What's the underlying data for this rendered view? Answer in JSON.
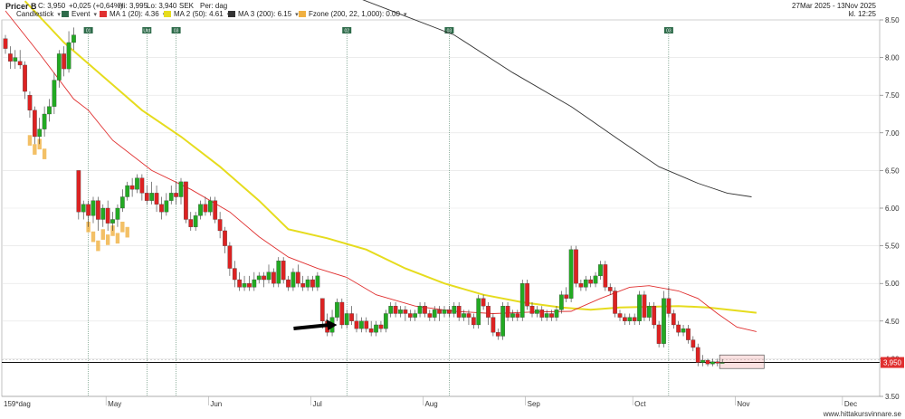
{
  "header": {
    "instrument": "Pricer B",
    "close": "C: 3,950",
    "change": "+0,025 (+0,64%)",
    "high": "Hi: 3,995",
    "low": "Lo: 3,940",
    "currency": "SEK",
    "period": "Per: dag",
    "date_range": "27Mar 2025 - 13Nov 2025",
    "time": "kl. 12:25",
    "legend": [
      {
        "label": "Candlestick",
        "color": "",
        "dropdown": "▾"
      },
      {
        "label": "Event",
        "color": "#2e6b4a",
        "dropdown": "▾"
      },
      {
        "label": "MA 1 (20): 4.36",
        "color": "#e03030",
        "dropdown": "▾"
      },
      {
        "label": "MA 2 (50): 4.61",
        "color": "#e6dc1e",
        "dropdown": "▾"
      },
      {
        "label": "MA 3 (200): 6.15",
        "color": "#333333",
        "dropdown": "▾"
      },
      {
        "label": "Fzone (200, 22, 1,000): 0.00",
        "color": "#f0b040",
        "dropdown": "▾"
      }
    ]
  },
  "range_label": "159*dag",
  "price_marker": "3,950",
  "footer": "www.hittakursvinnare.se",
  "colors": {
    "up": "#22aa22",
    "down": "#dd2222",
    "ma1": "#e03030",
    "ma2": "#e6dc1e",
    "ma3": "#333333",
    "fzone": "#f0b040",
    "event": "#2e6b4a",
    "marker_bg": "#e03030"
  },
  "chart_data": {
    "type": "candlestick",
    "ylim": [
      3.5,
      8.5
    ],
    "y_ticks": [
      "3.50",
      "4.00",
      "4.50",
      "5.00",
      "5.50",
      "6.00",
      "6.50",
      "7.00",
      "7.50",
      "8.00",
      "8.50"
    ],
    "y_tick_values": [
      3.5,
      4.0,
      4.5,
      5.0,
      5.5,
      6.0,
      6.5,
      7.0,
      7.5,
      8.0,
      8.5
    ],
    "month_labels": [
      "May",
      "Jun",
      "Jul",
      "Aug",
      "Sep",
      "Oct",
      "Nov",
      "Dec"
    ],
    "month_index": [
      21,
      42,
      63,
      86,
      107,
      129,
      150,
      172
    ],
    "num_slots": 180,
    "events": [
      {
        "label": "01",
        "index": 17
      },
      {
        "label": "Utd",
        "index": 29
      },
      {
        "label": "03",
        "index": 35
      },
      {
        "label": "02",
        "index": 70
      },
      {
        "label": "03",
        "index": 91
      },
      {
        "label": "03",
        "index": 136
      }
    ],
    "candles": [
      [
        8.25,
        8.12,
        8.3,
        8.05
      ],
      [
        8.05,
        7.95,
        8.15,
        7.85
      ],
      [
        7.95,
        8.0,
        8.1,
        7.85
      ],
      [
        7.95,
        7.9,
        8.1,
        7.85
      ],
      [
        7.9,
        7.55,
        7.95,
        7.45
      ],
      [
        7.5,
        7.3,
        7.55,
        7.2
      ],
      [
        7.3,
        6.95,
        7.35,
        6.85
      ],
      [
        6.95,
        7.05,
        7.2,
        6.85
      ],
      [
        7.05,
        7.25,
        7.35,
        6.95
      ],
      [
        7.25,
        7.35,
        7.45,
        7.15
      ],
      [
        7.35,
        7.7,
        7.8,
        7.25
      ],
      [
        7.7,
        8.05,
        8.1,
        7.6
      ],
      [
        8.05,
        7.85,
        8.15,
        7.75
      ],
      [
        7.85,
        8.2,
        8.35,
        7.8
      ],
      [
        8.2,
        8.3,
        8.4,
        8.1
      ],
      [
        6.5,
        5.95,
        6.5,
        5.85
      ],
      [
        5.95,
        6.05,
        6.1,
        5.85
      ],
      [
        6.05,
        5.9,
        6.1,
        5.75
      ],
      [
        5.9,
        6.1,
        6.15,
        5.8
      ],
      [
        6.1,
        5.85,
        6.15,
        5.7
      ],
      [
        5.85,
        6.0,
        6.05,
        5.75
      ],
      [
        6.0,
        5.8,
        6.1,
        5.7
      ],
      [
        5.8,
        5.85,
        5.95,
        5.7
      ],
      [
        5.85,
        6.0,
        6.05,
        5.75
      ],
      [
        6.0,
        6.15,
        6.25,
        5.95
      ],
      [
        6.15,
        6.3,
        6.35,
        6.1
      ],
      [
        6.3,
        6.25,
        6.4,
        6.15
      ],
      [
        6.25,
        6.4,
        6.45,
        6.2
      ],
      [
        6.4,
        6.2,
        6.45,
        6.1
      ],
      [
        6.2,
        6.1,
        6.3,
        6.05
      ],
      [
        6.1,
        6.2,
        6.35,
        6.05
      ],
      [
        6.2,
        6.05,
        6.3,
        5.95
      ],
      [
        6.05,
        5.95,
        6.15,
        5.85
      ],
      [
        5.95,
        6.1,
        6.2,
        5.9
      ],
      [
        6.1,
        6.2,
        6.3,
        6.05
      ],
      [
        6.2,
        6.15,
        6.35,
        6.05
      ],
      [
        6.15,
        6.35,
        6.4,
        6.05
      ],
      [
        6.35,
        5.85,
        6.35,
        5.8
      ],
      [
        5.85,
        5.75,
        5.95,
        5.7
      ],
      [
        5.75,
        5.9,
        5.95,
        5.7
      ],
      [
        5.9,
        6.05,
        6.1,
        5.85
      ],
      [
        6.05,
        5.95,
        6.15,
        5.9
      ],
      [
        5.95,
        6.1,
        6.15,
        5.9
      ],
      [
        6.1,
        5.85,
        6.15,
        5.8
      ],
      [
        5.85,
        5.7,
        5.95,
        5.6
      ],
      [
        5.7,
        5.5,
        5.75,
        5.4
      ],
      [
        5.5,
        5.2,
        5.55,
        5.1
      ],
      [
        5.2,
        5.05,
        5.3,
        4.95
      ],
      [
        5.05,
        4.95,
        5.15,
        4.9
      ],
      [
        4.95,
        5.0,
        5.1,
        4.9
      ],
      [
        5.0,
        4.95,
        5.1,
        4.9
      ],
      [
        4.95,
        5.05,
        5.15,
        4.9
      ],
      [
        5.05,
        5.1,
        5.15,
        5.0
      ],
      [
        5.1,
        5.05,
        5.15,
        4.95
      ],
      [
        5.05,
        5.15,
        5.25,
        5.0
      ],
      [
        5.15,
        5.0,
        5.2,
        4.95
      ],
      [
        5.0,
        5.3,
        5.35,
        4.95
      ],
      [
        5.3,
        5.05,
        5.35,
        5.0
      ],
      [
        5.05,
        4.95,
        5.1,
        4.9
      ],
      [
        4.95,
        5.15,
        5.2,
        4.9
      ],
      [
        5.15,
        5.0,
        5.25,
        4.95
      ],
      [
        5.0,
        4.95,
        5.1,
        4.9
      ],
      [
        4.95,
        5.05,
        5.1,
        4.9
      ],
      [
        5.05,
        4.95,
        5.1,
        4.9
      ],
      [
        4.95,
        5.1,
        5.15,
        4.9
      ],
      [
        4.8,
        4.5,
        4.8,
        4.4
      ],
      [
        4.5,
        4.35,
        4.6,
        4.3
      ],
      [
        4.35,
        4.55,
        4.65,
        4.3
      ],
      [
        4.55,
        4.75,
        4.8,
        4.5
      ],
      [
        4.75,
        4.45,
        4.8,
        4.4
      ],
      [
        4.45,
        4.6,
        4.65,
        4.4
      ],
      [
        4.6,
        4.5,
        4.7,
        4.45
      ],
      [
        4.5,
        4.4,
        4.6,
        4.35
      ],
      [
        4.4,
        4.5,
        4.55,
        4.35
      ],
      [
        4.5,
        4.4,
        4.55,
        4.35
      ],
      [
        4.4,
        4.35,
        4.5,
        4.3
      ],
      [
        4.35,
        4.45,
        4.5,
        4.3
      ],
      [
        4.45,
        4.4,
        4.5,
        4.35
      ],
      [
        4.4,
        4.6,
        4.65,
        4.35
      ],
      [
        4.6,
        4.7,
        4.75,
        4.55
      ],
      [
        4.7,
        4.6,
        4.75,
        4.55
      ],
      [
        4.6,
        4.65,
        4.7,
        4.55
      ],
      [
        4.65,
        4.6,
        4.7,
        4.5
      ],
      [
        4.6,
        4.55,
        4.65,
        4.5
      ],
      [
        4.55,
        4.6,
        4.65,
        4.5
      ],
      [
        4.6,
        4.7,
        4.75,
        4.55
      ],
      [
        4.7,
        4.6,
        4.75,
        4.55
      ],
      [
        4.6,
        4.55,
        4.65,
        4.5
      ],
      [
        4.55,
        4.65,
        4.7,
        4.5
      ],
      [
        4.65,
        4.6,
        4.7,
        4.5
      ],
      [
        4.6,
        4.65,
        4.7,
        4.55
      ],
      [
        4.65,
        4.6,
        4.7,
        4.55
      ],
      [
        4.6,
        4.7,
        4.75,
        4.55
      ],
      [
        4.7,
        4.55,
        4.75,
        4.5
      ],
      [
        4.55,
        4.6,
        4.65,
        4.5
      ],
      [
        4.6,
        4.55,
        4.65,
        4.45
      ],
      [
        4.55,
        4.45,
        4.6,
        4.4
      ],
      [
        4.45,
        4.8,
        4.85,
        4.4
      ],
      [
        4.8,
        4.7,
        4.85,
        4.65
      ],
      [
        4.7,
        4.55,
        4.75,
        4.45
      ],
      [
        4.55,
        4.35,
        4.6,
        4.3
      ],
      [
        4.35,
        4.3,
        4.4,
        4.25
      ],
      [
        4.3,
        4.7,
        4.75,
        4.25
      ],
      [
        4.7,
        4.55,
        4.75,
        4.5
      ],
      [
        4.55,
        4.6,
        4.65,
        4.5
      ],
      [
        4.6,
        4.55,
        4.65,
        4.5
      ],
      [
        4.55,
        5.0,
        5.05,
        4.5
      ],
      [
        5.0,
        4.7,
        5.05,
        4.65
      ],
      [
        4.7,
        4.6,
        4.75,
        4.55
      ],
      [
        4.6,
        4.65,
        4.7,
        4.55
      ],
      [
        4.65,
        4.55,
        4.7,
        4.5
      ],
      [
        4.55,
        4.6,
        4.65,
        4.5
      ],
      [
        4.6,
        4.55,
        4.65,
        4.5
      ],
      [
        4.55,
        4.65,
        4.7,
        4.5
      ],
      [
        4.65,
        4.85,
        4.9,
        4.6
      ],
      [
        4.85,
        4.8,
        4.95,
        4.75
      ],
      [
        4.8,
        5.45,
        5.5,
        4.75
      ],
      [
        5.45,
        5.0,
        5.5,
        4.95
      ],
      [
        5.0,
        4.95,
        5.05,
        4.9
      ],
      [
        4.95,
        5.05,
        5.1,
        4.9
      ],
      [
        5.05,
        5.0,
        5.1,
        4.95
      ],
      [
        5.0,
        5.1,
        5.15,
        4.95
      ],
      [
        5.1,
        5.25,
        5.3,
        5.05
      ],
      [
        5.25,
        4.95,
        5.3,
        4.9
      ],
      [
        4.95,
        4.9,
        5.0,
        4.85
      ],
      [
        4.9,
        4.6,
        4.95,
        4.55
      ],
      [
        4.6,
        4.55,
        4.65,
        4.5
      ],
      [
        4.55,
        4.5,
        4.6,
        4.45
      ],
      [
        4.5,
        4.55,
        4.6,
        4.45
      ],
      [
        4.55,
        4.5,
        4.6,
        4.45
      ],
      [
        4.5,
        4.85,
        4.9,
        4.45
      ],
      [
        4.85,
        4.55,
        4.9,
        4.5
      ],
      [
        4.55,
        4.7,
        4.75,
        4.5
      ],
      [
        4.7,
        4.45,
        4.75,
        4.4
      ],
      [
        4.45,
        4.2,
        4.5,
        4.15
      ],
      [
        4.2,
        4.8,
        4.9,
        4.15
      ],
      [
        4.8,
        4.6,
        4.95,
        4.55
      ],
      [
        4.6,
        4.45,
        4.65,
        4.4
      ],
      [
        4.45,
        4.35,
        4.5,
        4.3
      ],
      [
        4.35,
        4.4,
        4.45,
        4.3
      ],
      [
        4.4,
        4.25,
        4.45,
        4.2
      ],
      [
        4.25,
        4.15,
        4.3,
        4.1
      ],
      [
        4.15,
        3.95,
        4.2,
        3.9
      ],
      [
        3.95,
        3.98,
        4.05,
        3.9
      ],
      [
        3.98,
        3.93,
        4.0,
        3.9
      ],
      [
        3.93,
        3.96,
        4.0,
        3.9
      ],
      [
        3.96,
        3.94,
        4.0,
        3.9
      ],
      [
        3.94,
        3.95,
        3.995,
        3.94
      ]
    ],
    "ma1": [
      [
        0,
        8.62
      ],
      [
        7,
        8.05
      ],
      [
        14,
        7.45
      ],
      [
        17,
        7.3
      ],
      [
        22,
        6.9
      ],
      [
        30,
        6.5
      ],
      [
        38,
        6.25
      ],
      [
        46,
        5.95
      ],
      [
        52,
        5.62
      ],
      [
        58,
        5.35
      ],
      [
        64,
        5.2
      ],
      [
        70,
        5.08
      ],
      [
        76,
        4.85
      ],
      [
        84,
        4.7
      ],
      [
        92,
        4.63
      ],
      [
        100,
        4.6
      ],
      [
        108,
        4.62
      ],
      [
        116,
        4.63
      ],
      [
        122,
        4.8
      ],
      [
        128,
        4.95
      ],
      [
        132,
        4.97
      ],
      [
        138,
        4.9
      ],
      [
        142,
        4.8
      ],
      [
        146,
        4.6
      ],
      [
        150,
        4.42
      ],
      [
        154,
        4.36
      ]
    ],
    "ma2": [
      [
        4,
        8.75
      ],
      [
        12,
        8.2
      ],
      [
        20,
        7.75
      ],
      [
        28,
        7.3
      ],
      [
        36,
        6.95
      ],
      [
        44,
        6.55
      ],
      [
        52,
        6.1
      ],
      [
        58,
        5.72
      ],
      [
        66,
        5.6
      ],
      [
        74,
        5.45
      ],
      [
        82,
        5.2
      ],
      [
        90,
        5.0
      ],
      [
        98,
        4.85
      ],
      [
        106,
        4.75
      ],
      [
        114,
        4.68
      ],
      [
        120,
        4.65
      ],
      [
        126,
        4.68
      ],
      [
        132,
        4.69
      ],
      [
        138,
        4.7
      ],
      [
        144,
        4.68
      ],
      [
        150,
        4.64
      ],
      [
        154,
        4.61
      ]
    ],
    "ma3": [
      [
        70,
        8.85
      ],
      [
        80,
        8.6
      ],
      [
        92,
        8.3
      ],
      [
        104,
        7.8
      ],
      [
        116,
        7.35
      ],
      [
        126,
        6.9
      ],
      [
        134,
        6.55
      ],
      [
        142,
        6.33
      ],
      [
        148,
        6.2
      ],
      [
        153,
        6.15
      ]
    ],
    "fzone": [
      [
        5,
        6.9
      ],
      [
        6,
        6.78
      ],
      [
        7,
        6.85
      ],
      [
        8,
        6.72
      ],
      [
        17,
        5.75
      ],
      [
        18,
        5.62
      ],
      [
        19,
        5.5
      ],
      [
        20,
        5.65
      ],
      [
        21,
        5.58
      ],
      [
        22,
        5.7
      ],
      [
        23,
        5.6
      ],
      [
        24,
        5.75
      ],
      [
        25,
        5.68
      ]
    ],
    "arrow_index": 68,
    "arrow_value": 4.45,
    "marker_value": 3.95,
    "zone": {
      "start_index": 147,
      "end_index": 155,
      "low": 3.87,
      "high": 4.05
    }
  }
}
